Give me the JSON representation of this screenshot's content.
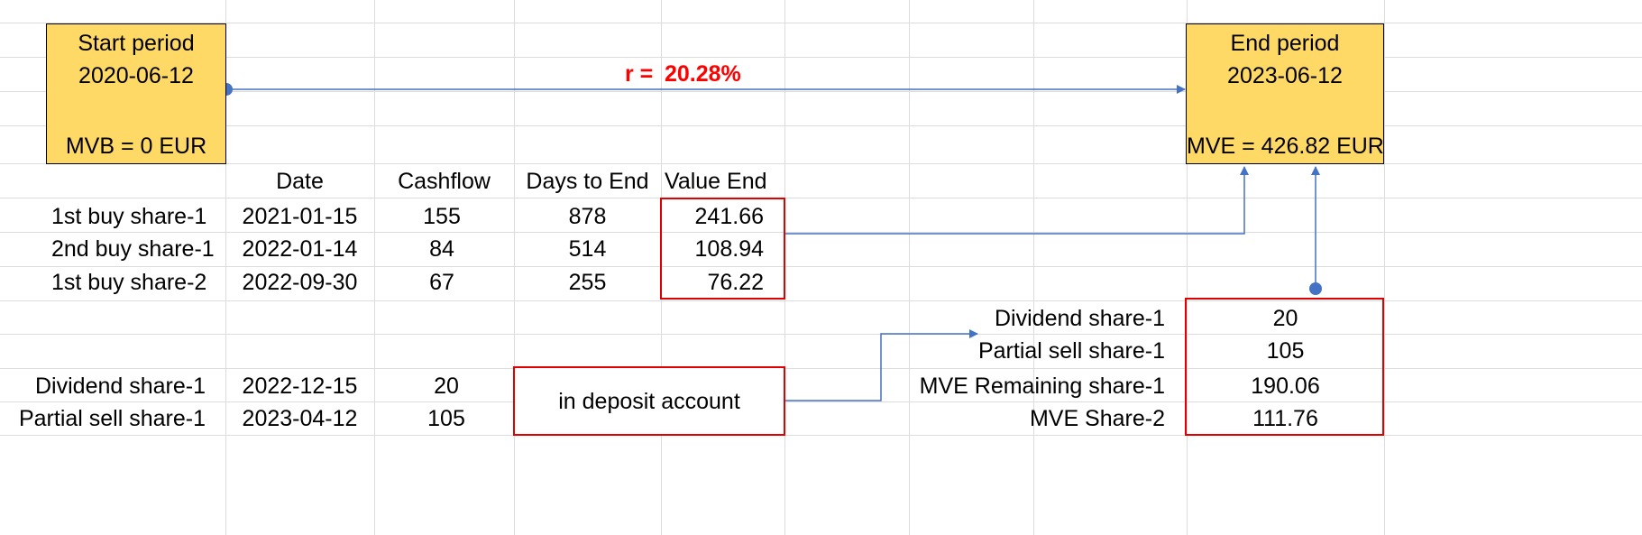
{
  "start_period": {
    "title": "Start period",
    "date": "2020-06-12",
    "value": "MVB = 0 EUR"
  },
  "end_period": {
    "title": "End period",
    "date": "2023-06-12",
    "value": "MVE = 426.82 EUR"
  },
  "rate": {
    "label": "r =",
    "value": "20.28%"
  },
  "table": {
    "headers": [
      "Date",
      "Cashflow",
      "Days to End",
      "Value End"
    ],
    "rows": [
      {
        "label": "1st buy share-1",
        "date": "2021-01-15",
        "cashflow": "155",
        "days": "878",
        "value_end": "241.66"
      },
      {
        "label": "2nd buy share-1",
        "date": "2022-01-14",
        "cashflow": "84",
        "days": "514",
        "value_end": "108.94"
      },
      {
        "label": "1st buy share-2",
        "date": "2022-09-30",
        "cashflow": "67",
        "days": "255",
        "value_end": "76.22"
      }
    ]
  },
  "cash_rows": [
    {
      "label": "Dividend share-1",
      "date": "2022-12-15",
      "amount": "20"
    },
    {
      "label": "Partial sell share-1",
      "date": "2023-04-12",
      "amount": "105"
    }
  ],
  "deposit_note": "in deposit account",
  "summary": [
    {
      "label": "Dividend share-1",
      "value": "20"
    },
    {
      "label": "Partial sell share-1",
      "value": "105"
    },
    {
      "label": "MVE Remaining share-1",
      "value": "190.06"
    },
    {
      "label": "MVE Share-2",
      "value": "111.76"
    }
  ],
  "colors": {
    "period_fill": "#ffd966",
    "highlight_border": "#e00000",
    "connector": "#4472c4",
    "rate_text": "#ff0000"
  }
}
